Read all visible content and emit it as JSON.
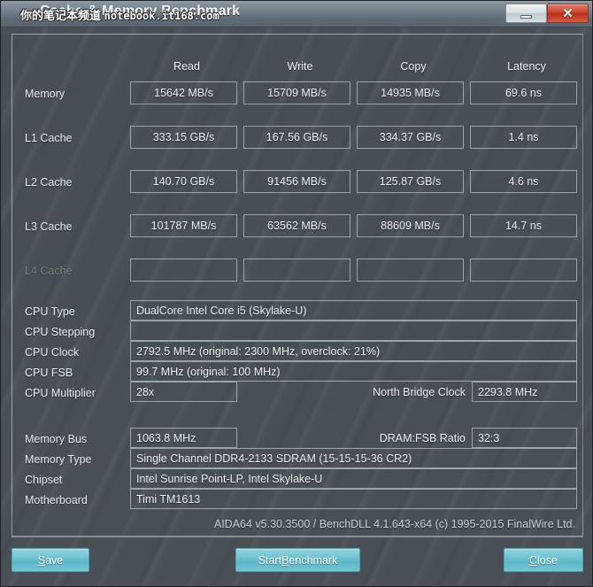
{
  "window": {
    "title": "Cache & Memory Benchmark",
    "watermark_cn": "你的笔记本频道",
    "watermark_en": "notebook.it168.com",
    "minimize_label": "Minimize",
    "close_label": "Close",
    "close_glyph": "✕"
  },
  "colors": {
    "accent_button": "#6fc3d2",
    "close_button": "#cf4a33",
    "field_border": "#9aa4ab",
    "text": "#e8edf0",
    "text_disabled": "#73827d",
    "panel_bg": "#484f55"
  },
  "benchmark_table": {
    "columns": [
      "Read",
      "Write",
      "Copy",
      "Latency"
    ],
    "rows": [
      {
        "label": "Memory",
        "disabled": false,
        "values": [
          "15642 MB/s",
          "15709 MB/s",
          "14935 MB/s",
          "69.6 ns"
        ]
      },
      {
        "label": "L1 Cache",
        "disabled": false,
        "values": [
          "333.15 GB/s",
          "167.56 GB/s",
          "334.37 GB/s",
          "1.4 ns"
        ]
      },
      {
        "label": "L2 Cache",
        "disabled": false,
        "values": [
          "140.70 GB/s",
          "91456 MB/s",
          "125.87 GB/s",
          "4.6 ns"
        ]
      },
      {
        "label": "L3 Cache",
        "disabled": false,
        "values": [
          "101787 MB/s",
          "63562 MB/s",
          "88609 MB/s",
          "14.7 ns"
        ]
      },
      {
        "label": "L4 Cache",
        "disabled": true,
        "values": [
          "",
          "",
          "",
          ""
        ]
      }
    ]
  },
  "system_info": {
    "cpu_type": {
      "label": "CPU Type",
      "value": "DualCore Intel Core i5  (Skylake-U)"
    },
    "cpu_stepping": {
      "label": "CPU Stepping",
      "value": ""
    },
    "cpu_clock": {
      "label": "CPU Clock",
      "value": "2792.5 MHz  (original: 2300 MHz, overclock: 21%)"
    },
    "cpu_fsb": {
      "label": "CPU FSB",
      "value": "99.7 MHz  (original: 100 MHz)"
    },
    "cpu_multiplier": {
      "label": "CPU Multiplier",
      "value": "28x"
    },
    "north_bridge_clock": {
      "label": "North Bridge Clock",
      "value": "2293.8 MHz"
    },
    "memory_bus": {
      "label": "Memory Bus",
      "value": "1063.8 MHz"
    },
    "dram_fsb_ratio": {
      "label": "DRAM:FSB Ratio",
      "value": "32:3"
    },
    "memory_type": {
      "label": "Memory Type",
      "value": "Single Channel DDR4-2133 SDRAM  (15-15-15-36 CR2)"
    },
    "chipset": {
      "label": "Chipset",
      "value": "Intel Sunrise Point-LP, Intel Skylake-U"
    },
    "motherboard": {
      "label": "Motherboard",
      "value": "Timi TM1613"
    }
  },
  "footer": {
    "version_text": "AIDA64 v5.30.3500 / BenchDLL 4.1.643-x64  (c) 1995-2015 FinalWire Ltd."
  },
  "buttons": {
    "save": {
      "pre": "",
      "accel": "S",
      "post": "ave"
    },
    "start_benchmark": {
      "pre": "Start ",
      "accel": "B",
      "post": "enchmark"
    },
    "close": {
      "pre": "",
      "accel": "C",
      "post": "lose"
    }
  }
}
